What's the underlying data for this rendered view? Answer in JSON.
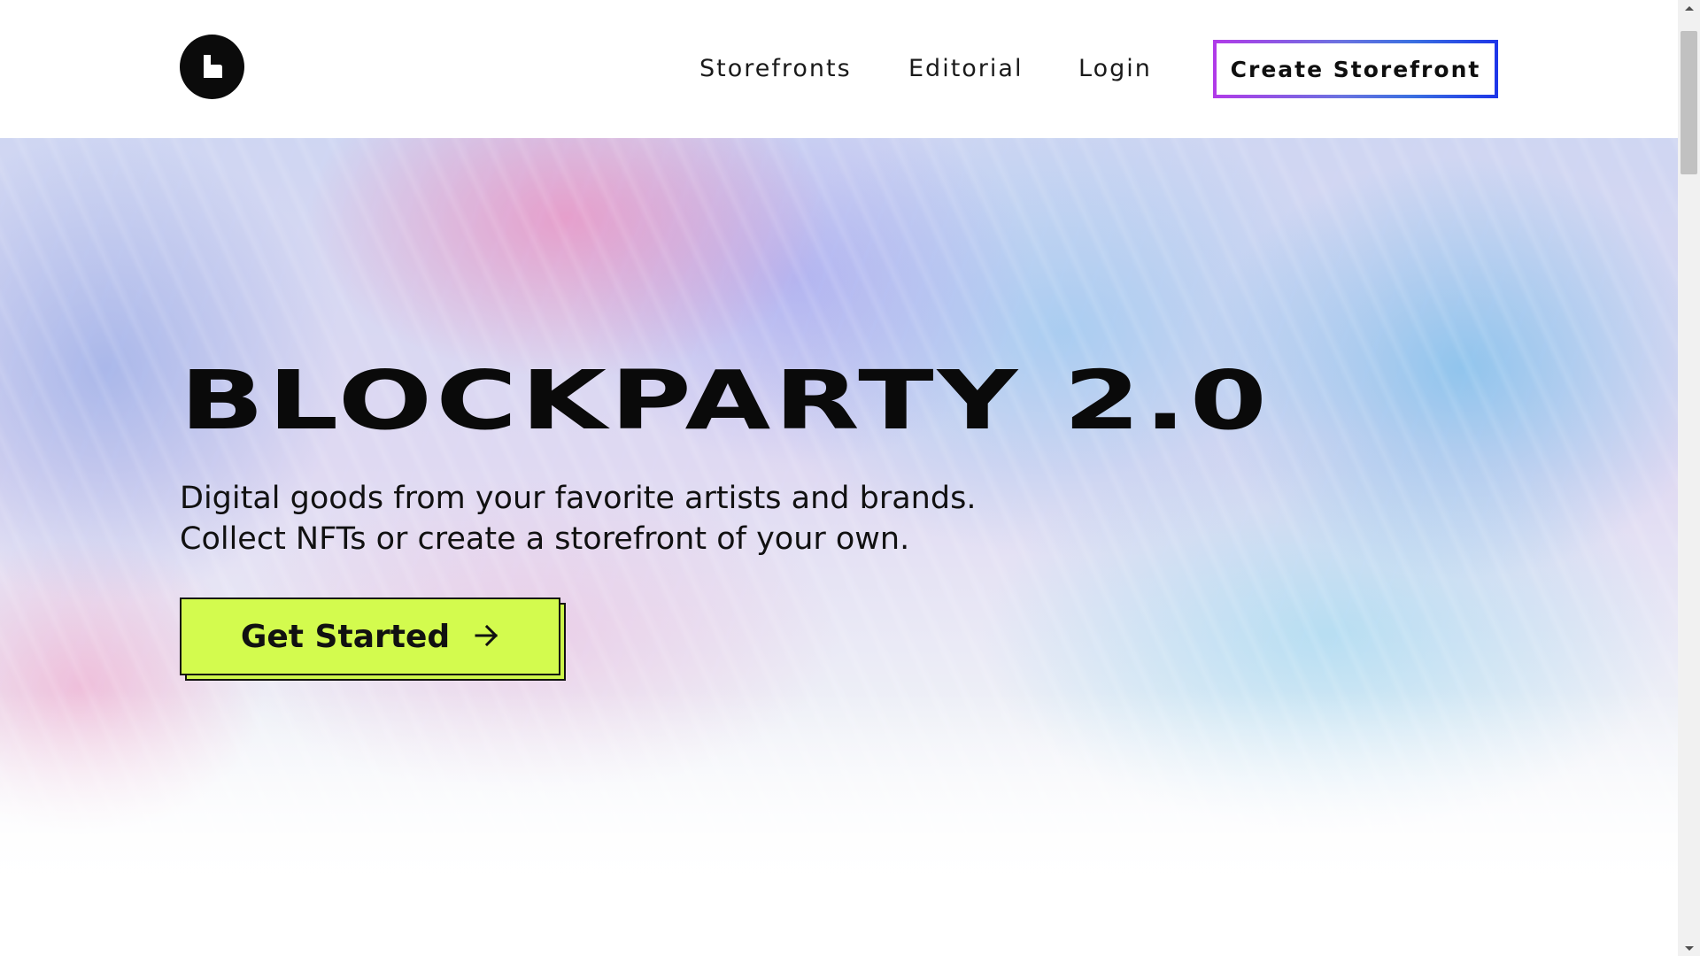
{
  "header": {
    "logo_label": "Blockparty logo",
    "nav": {
      "storefronts": "Storefronts",
      "editorial": "Editorial",
      "login": "Login"
    },
    "cta": "Create Storefront"
  },
  "hero": {
    "title": "BLOCKPARTY 2.0",
    "subtitle_line1": "Digital goods from your favorite artists and brands.",
    "subtitle_line2": "Collect NFTs or create a storefront of your own.",
    "button": "Get Started"
  },
  "colors": {
    "accent_lime": "#d3fb4e",
    "cta_gradient_start": "#b13ae8",
    "cta_gradient_end": "#1d35e8",
    "text": "#111111"
  },
  "icons": {
    "logo": "logo-icon",
    "arrow": "arrow-right-icon",
    "scroll_up": "scroll-up-arrow-icon",
    "scroll_down": "scroll-down-arrow-icon"
  }
}
